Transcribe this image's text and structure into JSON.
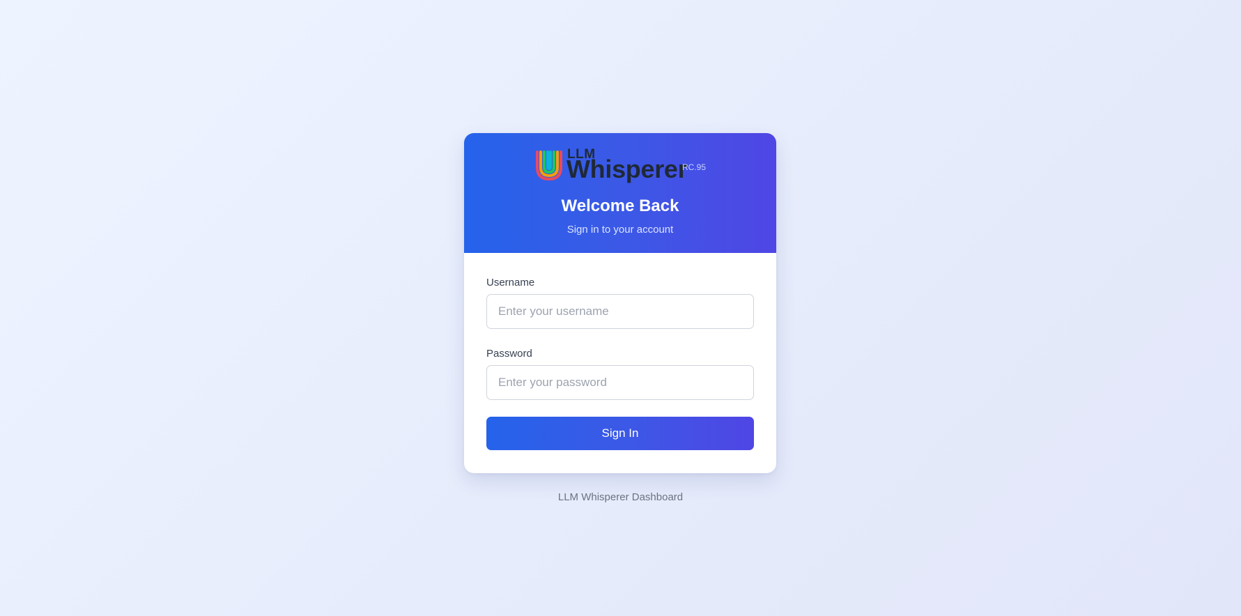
{
  "header": {
    "logo_small": "LLM",
    "logo_big": "Whisperer",
    "version": "RC.95",
    "title": "Welcome Back",
    "subtitle": "Sign in to your account"
  },
  "form": {
    "username_label": "Username",
    "username_placeholder": "Enter your username",
    "username_value": "",
    "password_label": "Password",
    "password_placeholder": "Enter your password",
    "password_value": "",
    "submit_label": "Sign In"
  },
  "footer": {
    "text": "LLM Whisperer Dashboard"
  },
  "colors": {
    "accent_start": "#2563eb",
    "accent_end": "#4f46e5",
    "background": "#e8eefc"
  },
  "icons": {
    "logo": "llm-whisperer-u-logo"
  }
}
